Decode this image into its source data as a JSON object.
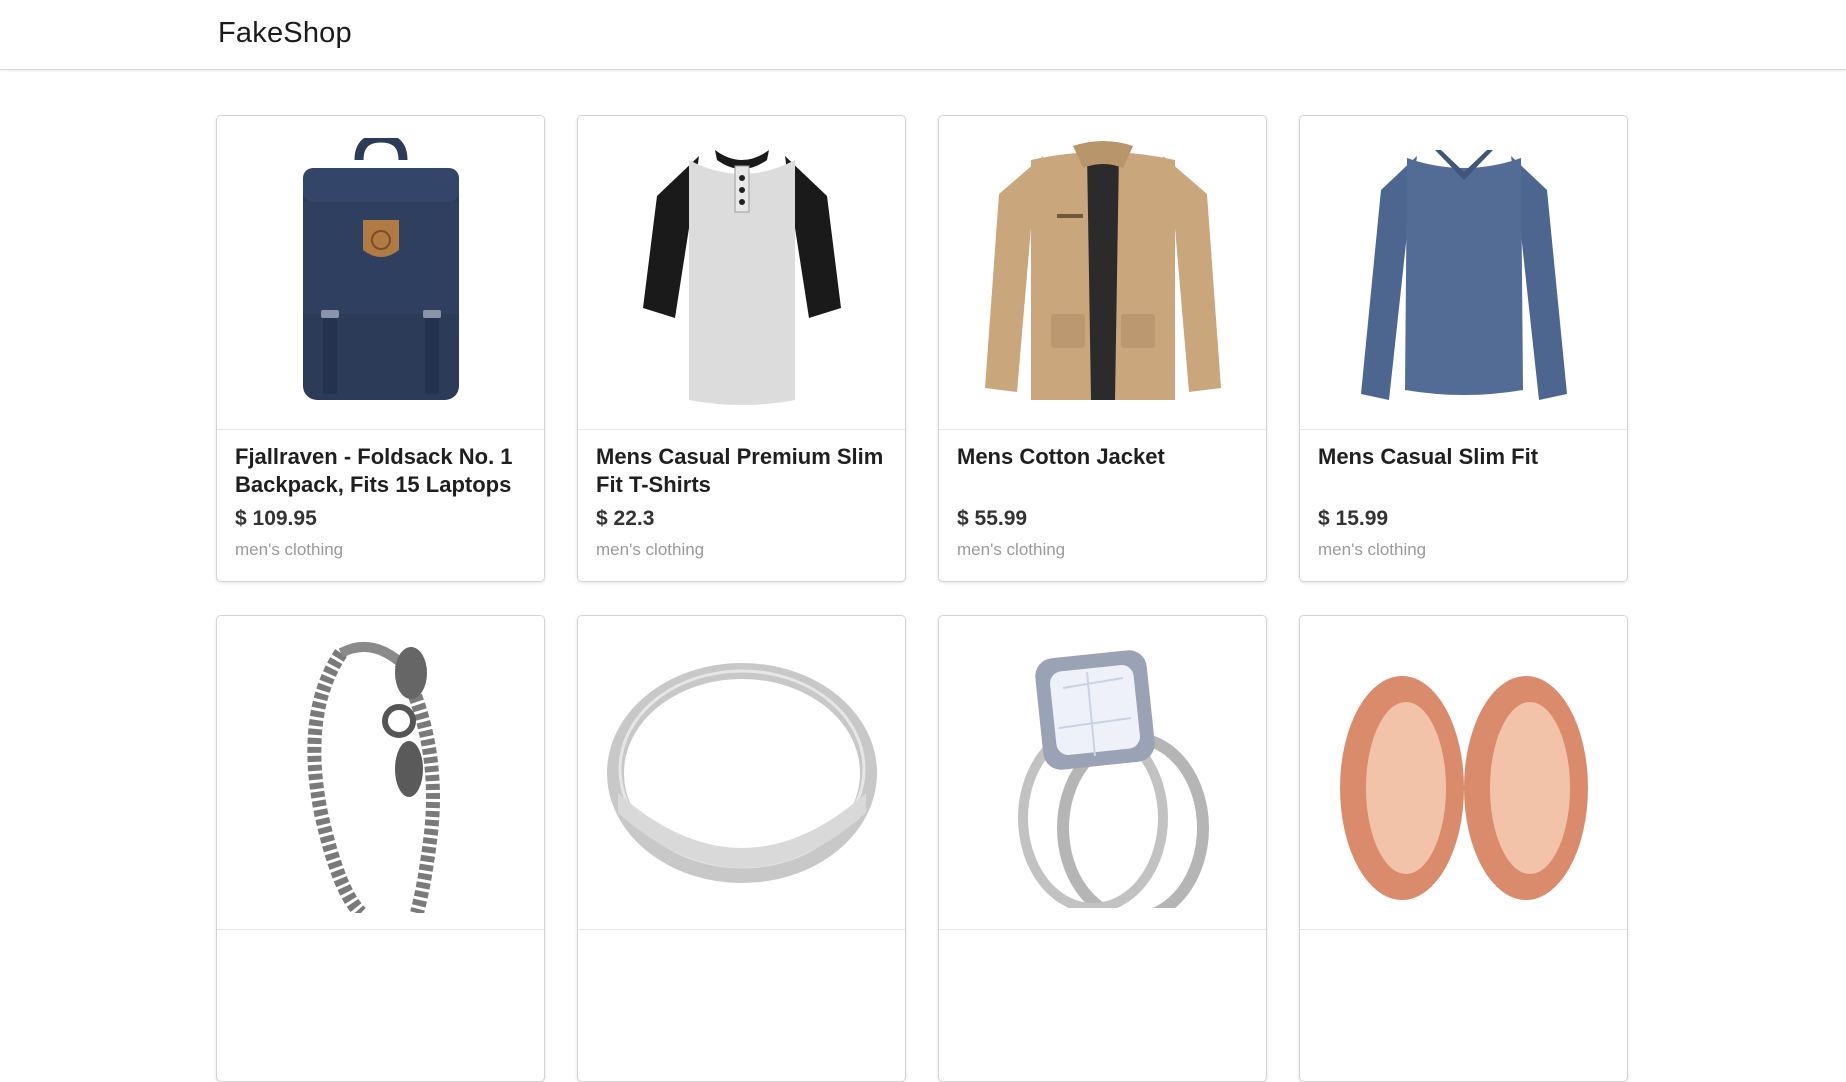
{
  "header": {
    "brand": "FakeShop"
  },
  "currency_symbol": "$",
  "products": [
    {
      "title": "Fjallraven - Foldsack No. 1 Backpack, Fits 15 Laptops",
      "price": "$ 109.95",
      "category": "men's clothing",
      "image_icon": "backpack-icon"
    },
    {
      "title": "Mens Casual Premium Slim Fit T-Shirts",
      "price": "$ 22.3",
      "category": "men's clothing",
      "image_icon": "tshirt-icon"
    },
    {
      "title": "Mens Cotton Jacket",
      "price": "$ 55.99",
      "category": "men's clothing",
      "image_icon": "jacket-icon"
    },
    {
      "title": "Mens Casual Slim Fit",
      "price": "$ 15.99",
      "category": "men's clothing",
      "image_icon": "longsleeve-icon"
    },
    {
      "title": "",
      "price": "",
      "category": "",
      "image_icon": "bracelet-icon"
    },
    {
      "title": "",
      "price": "",
      "category": "",
      "image_icon": "ring-icon"
    },
    {
      "title": "",
      "price": "",
      "category": "",
      "image_icon": "diamond-ring-icon"
    },
    {
      "title": "",
      "price": "",
      "category": "",
      "image_icon": "ear-plugs-icon"
    }
  ],
  "colors": {
    "navy": "#2c3b57",
    "khaki": "#c9a67c",
    "steel_blue": "#4d6690",
    "rose_gold": "#d98b6b",
    "silver": "#a8a8a8"
  }
}
